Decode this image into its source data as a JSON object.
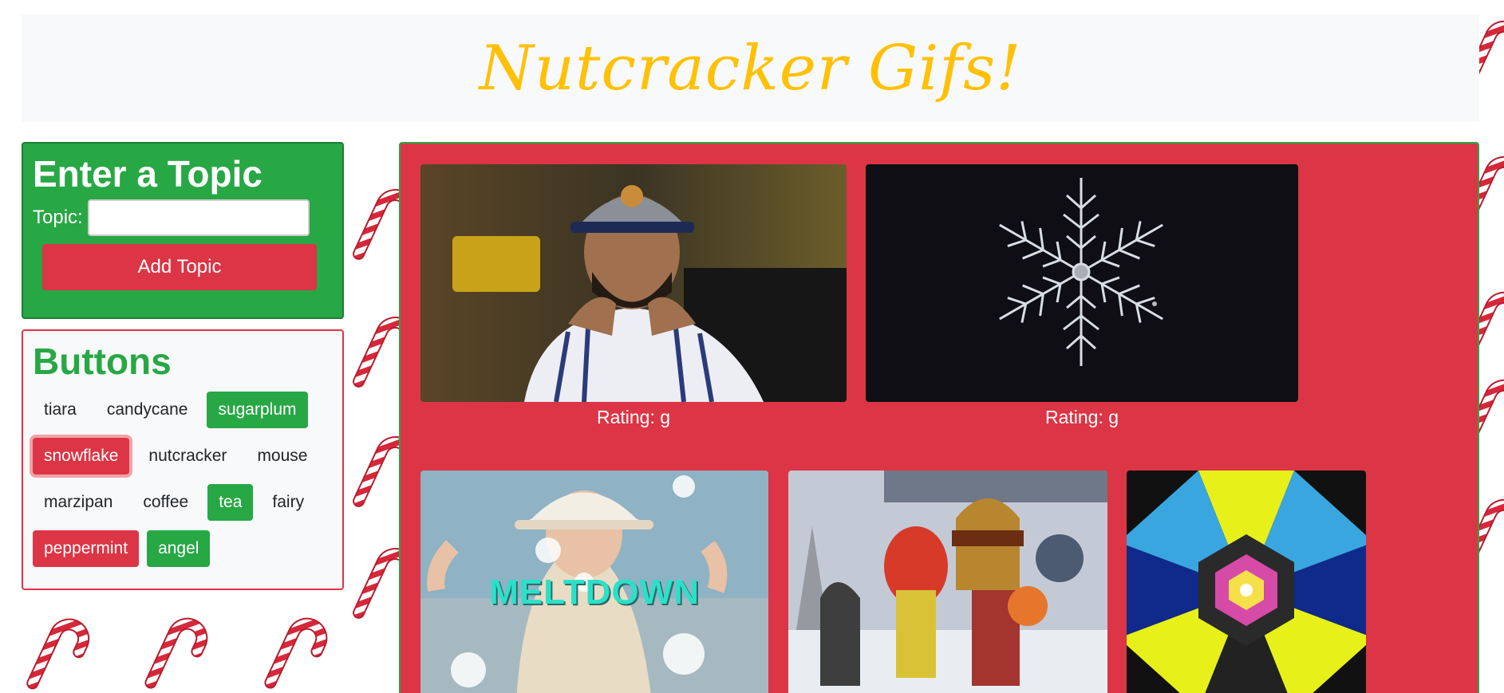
{
  "header": {
    "title": "Nutcracker Gifs!"
  },
  "topic_form": {
    "heading": "Enter a Topic",
    "label": "Topic:",
    "input_value": "",
    "submit_label": "Add Topic"
  },
  "buttons_panel": {
    "heading": "Buttons",
    "items": [
      {
        "label": "tiara",
        "style": "plain"
      },
      {
        "label": "candycane",
        "style": "plain"
      },
      {
        "label": "sugarplum",
        "style": "green"
      },
      {
        "label": "snowflake",
        "style": "red-active"
      },
      {
        "label": "nutcracker",
        "style": "plain"
      },
      {
        "label": "mouse",
        "style": "plain"
      },
      {
        "label": "marzipan",
        "style": "plain"
      },
      {
        "label": "coffee",
        "style": "plain"
      },
      {
        "label": "tea",
        "style": "green"
      },
      {
        "label": "fairy",
        "style": "plain"
      },
      {
        "label": "peppermint",
        "style": "red"
      },
      {
        "label": "angel",
        "style": "green"
      }
    ]
  },
  "gifs": [
    {
      "rating": "Rating: g",
      "overlay_text": ""
    },
    {
      "rating": "Rating: g",
      "overlay_text": ""
    },
    {
      "rating": "",
      "overlay_text": "MELTDOWN"
    },
    {
      "rating": "",
      "overlay_text": ""
    },
    {
      "rating": "",
      "overlay_text": ""
    }
  ],
  "colors": {
    "header_title": "#ffc107",
    "green": "#28a745",
    "red": "#dc3545",
    "light": "#f8f9fa"
  }
}
